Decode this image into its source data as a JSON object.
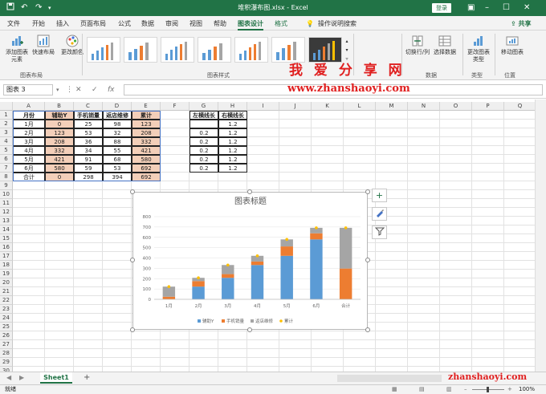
{
  "titlebar": {
    "title": "堆积瀑布图.xlsx - Excel",
    "login": "登录",
    "save_icon": "save-icon",
    "undo_icon": "undo-icon",
    "redo_icon": "redo-icon"
  },
  "tabs": [
    "文件",
    "开始",
    "插入",
    "页面布局",
    "公式",
    "数据",
    "审阅",
    "视图",
    "帮助",
    "图表设计",
    "格式"
  ],
  "tell_me": "操作说明搜索",
  "share": "共享",
  "ribbon": {
    "add_element": "添加图表元素",
    "quick_layout": "快速布局",
    "change_color": "更改颜色",
    "group_layouts": "图表布局",
    "group_styles": "图表样式",
    "switch_row_col": "切换行/列",
    "select_data": "选择数据",
    "group_data": "数据",
    "change_type": "更改图表类型",
    "group_type": "类型",
    "move_chart": "移动图表",
    "group_location": "位置"
  },
  "watermark": {
    "line1": "我 爱 分 享 网",
    "line2": "www.zhanshaoyi.com",
    "line3": "zhanshaoyi.com"
  },
  "formula": {
    "name_box": "图表 3",
    "cancel": "✕",
    "enter": "✓",
    "fx": "fx",
    "value": ""
  },
  "columns": [
    "A",
    "B",
    "C",
    "D",
    "E",
    "F",
    "G",
    "H",
    "I",
    "J",
    "K",
    "L",
    "M",
    "N",
    "O",
    "P",
    "Q"
  ],
  "rows": [
    "1",
    "2",
    "3",
    "4",
    "5",
    "6",
    "7",
    "8",
    "9",
    "10",
    "11",
    "12",
    "13",
    "14",
    "15",
    "16",
    "17",
    "18",
    "19",
    "20",
    "21",
    "22",
    "23",
    "24",
    "25",
    "26",
    "27",
    "28",
    "29",
    "30"
  ],
  "table": {
    "headers": [
      "月份",
      "辅助Y",
      "手机销量",
      "返店维修",
      "累计"
    ],
    "rows": [
      [
        "1月",
        "0",
        "25",
        "98",
        "123"
      ],
      [
        "2月",
        "123",
        "53",
        "32",
        "208"
      ],
      [
        "3月",
        "208",
        "36",
        "88",
        "332"
      ],
      [
        "4月",
        "332",
        "34",
        "55",
        "421"
      ],
      [
        "5月",
        "421",
        "91",
        "68",
        "580"
      ],
      [
        "6月",
        "580",
        "59",
        "53",
        "692"
      ],
      [
        "合计",
        "0",
        "298",
        "394",
        "692"
      ]
    ]
  },
  "table2": {
    "headers": [
      "左横线长",
      "右横线长"
    ],
    "rows": [
      [
        "",
        "1.2"
      ],
      [
        "0.2",
        "1.2"
      ],
      [
        "0.2",
        "1.2"
      ],
      [
        "0.2",
        "1.2"
      ],
      [
        "0.2",
        "1.2"
      ],
      [
        "0.2",
        "1.2"
      ]
    ]
  },
  "chart_data": {
    "type": "bar",
    "title": "图表标题",
    "categories": [
      "1月",
      "2月",
      "3月",
      "4月",
      "5月",
      "6月",
      "合计"
    ],
    "series": [
      {
        "name": "辅助Y",
        "values": [
          0,
          123,
          208,
          332,
          421,
          580,
          0
        ],
        "color": "#5b9bd5"
      },
      {
        "name": "手机销量",
        "values": [
          25,
          53,
          36,
          34,
          91,
          59,
          298
        ],
        "color": "#ed7d31"
      },
      {
        "name": "返店维修",
        "values": [
          98,
          32,
          88,
          55,
          68,
          53,
          394
        ],
        "color": "#a5a5a5"
      },
      {
        "name": "累计",
        "values": [
          123,
          208,
          332,
          421,
          580,
          692,
          692
        ],
        "color": "#ffc000",
        "kind": "scatter"
      }
    ],
    "stacked": true,
    "ylim": [
      0,
      800
    ],
    "yticks": [
      "0",
      "100",
      "200",
      "300",
      "400",
      "500",
      "600",
      "700",
      "800"
    ],
    "legend_position": "bottom",
    "grid": true
  },
  "sheet": {
    "tab": "Sheet1",
    "add": "+"
  },
  "status": {
    "ready": "就绪",
    "zoom": "100%"
  },
  "chart_buttons": {
    "elements": "+",
    "styles_icon": "brush-icon",
    "filter_icon": "filter-icon"
  }
}
